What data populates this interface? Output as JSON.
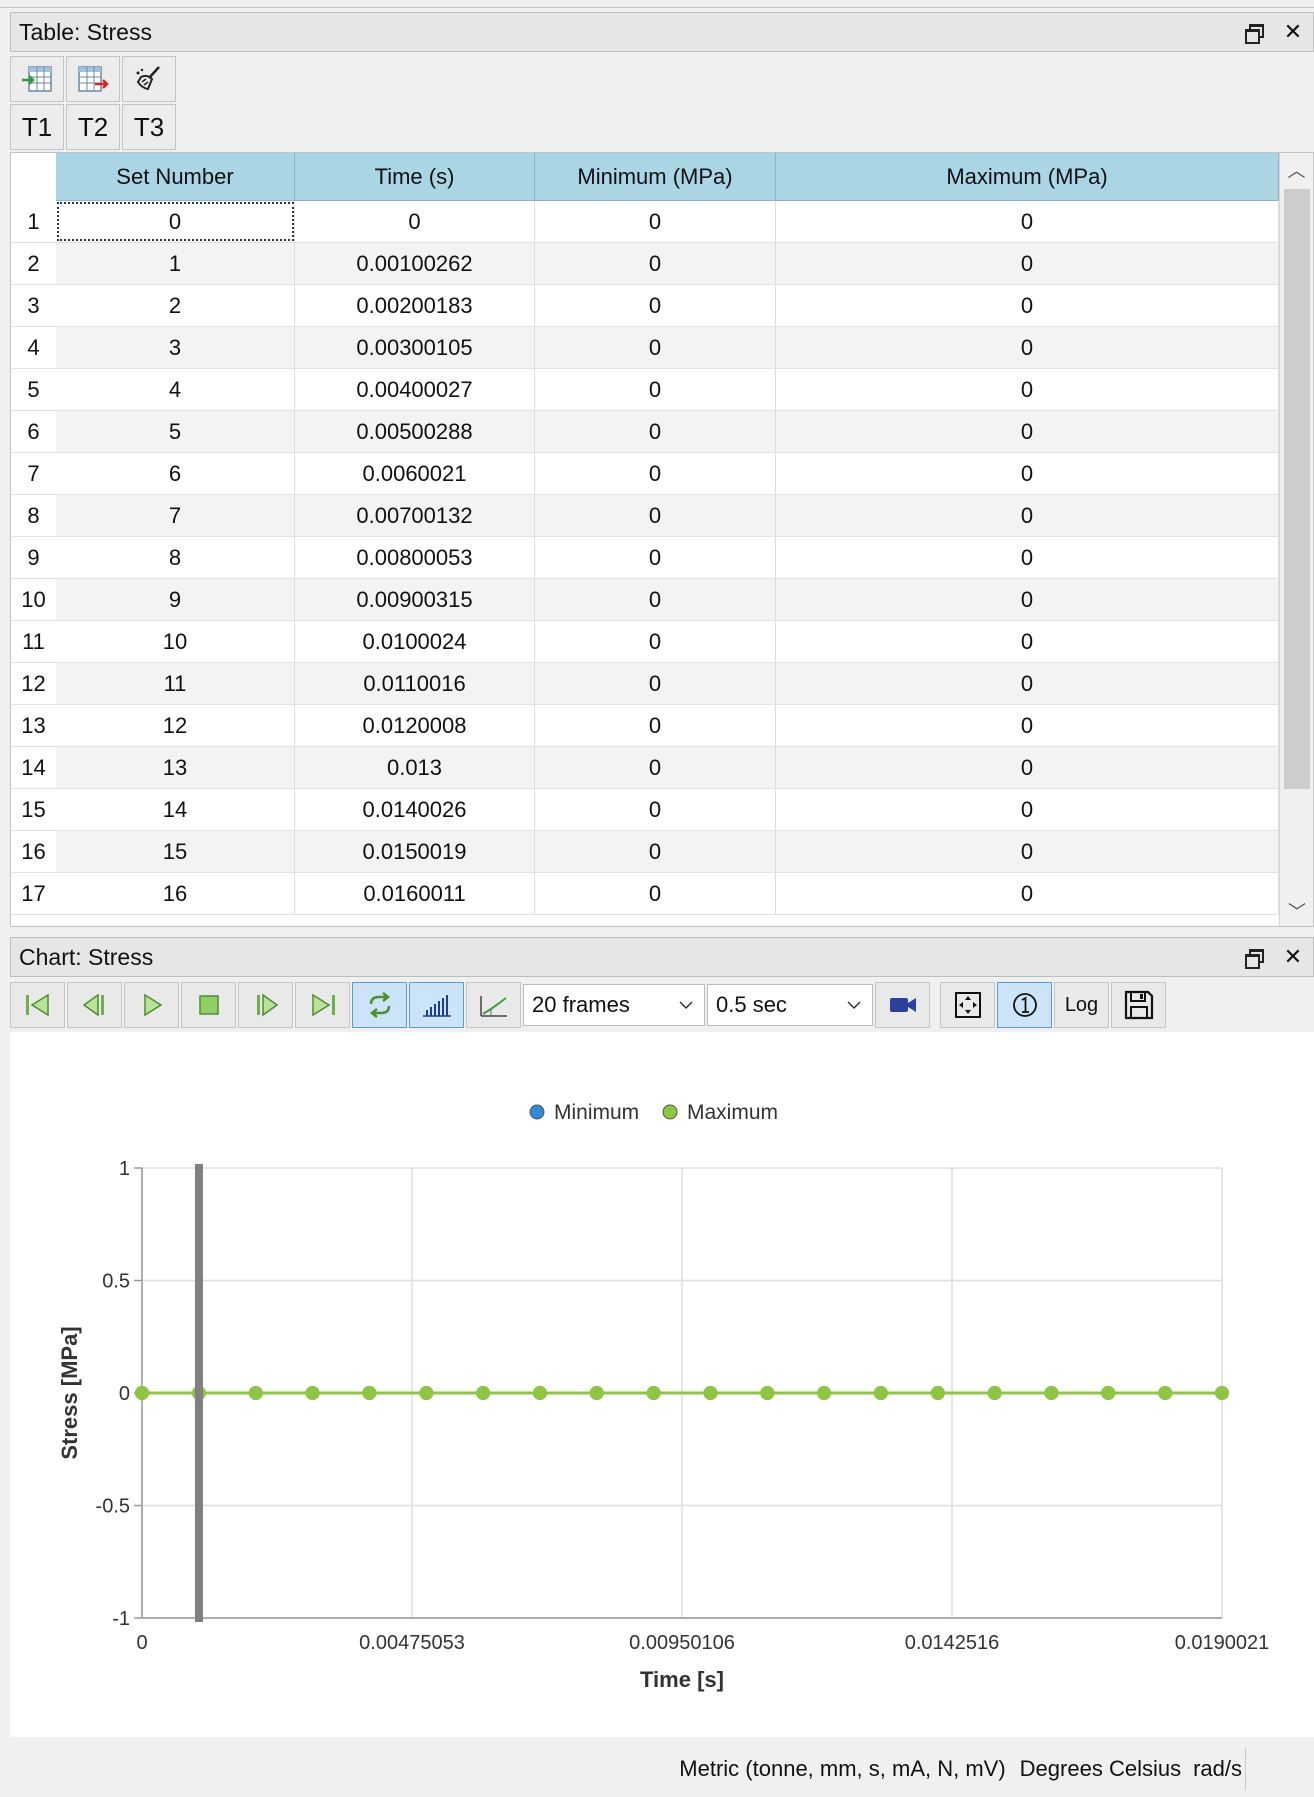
{
  "table_panel": {
    "title": "Table: Stress",
    "tabs": [
      "T1",
      "T2",
      "T3"
    ],
    "columns": [
      "Set Number",
      "Time (s)",
      "Minimum (MPa)",
      "Maximum (MPa)"
    ],
    "rows": [
      {
        "n": "1",
        "set": "0",
        "time": "0",
        "min": "0",
        "max": "0"
      },
      {
        "n": "2",
        "set": "1",
        "time": "0.00100262",
        "min": "0",
        "max": "0"
      },
      {
        "n": "3",
        "set": "2",
        "time": "0.00200183",
        "min": "0",
        "max": "0"
      },
      {
        "n": "4",
        "set": "3",
        "time": "0.00300105",
        "min": "0",
        "max": "0"
      },
      {
        "n": "5",
        "set": "4",
        "time": "0.00400027",
        "min": "0",
        "max": "0"
      },
      {
        "n": "6",
        "set": "5",
        "time": "0.00500288",
        "min": "0",
        "max": "0"
      },
      {
        "n": "7",
        "set": "6",
        "time": "0.0060021",
        "min": "0",
        "max": "0"
      },
      {
        "n": "8",
        "set": "7",
        "time": "0.00700132",
        "min": "0",
        "max": "0"
      },
      {
        "n": "9",
        "set": "8",
        "time": "0.00800053",
        "min": "0",
        "max": "0"
      },
      {
        "n": "10",
        "set": "9",
        "time": "0.00900315",
        "min": "0",
        "max": "0"
      },
      {
        "n": "11",
        "set": "10",
        "time": "0.0100024",
        "min": "0",
        "max": "0"
      },
      {
        "n": "12",
        "set": "11",
        "time": "0.0110016",
        "min": "0",
        "max": "0"
      },
      {
        "n": "13",
        "set": "12",
        "time": "0.0120008",
        "min": "0",
        "max": "0"
      },
      {
        "n": "14",
        "set": "13",
        "time": "0.013",
        "min": "0",
        "max": "0"
      },
      {
        "n": "15",
        "set": "14",
        "time": "0.0140026",
        "min": "0",
        "max": "0"
      },
      {
        "n": "16",
        "set": "15",
        "time": "0.0150019",
        "min": "0",
        "max": "0"
      },
      {
        "n": "17",
        "set": "16",
        "time": "0.0160011",
        "min": "0",
        "max": "0"
      }
    ]
  },
  "chart_panel": {
    "title": "Chart: Stress",
    "frames_select": "20 frames",
    "interval_select": "0.5 sec",
    "log_label": "Log",
    "active_buttons": [
      "loop",
      "bar-chart",
      "mark-one"
    ]
  },
  "chart_data": {
    "type": "line",
    "xlabel": "Time [s]",
    "ylabel": "Stress [MPa]",
    "xlim": [
      0,
      0.0190021
    ],
    "ylim": [
      -1,
      1
    ],
    "x_ticks": [
      "0",
      "0.00475053",
      "0.00950106",
      "0.0142516",
      "0.0190021"
    ],
    "y_ticks": [
      "1",
      "0.5",
      "0",
      "-0.5",
      "-1"
    ],
    "grid": true,
    "legend_position": "top-center",
    "cursor_x": 0.00100262,
    "series": [
      {
        "name": "Minimum",
        "color": "#2f8ad8",
        "x": [
          0,
          0.00100262,
          0.00200183,
          0.00300105,
          0.00400027,
          0.00500288,
          0.0060021,
          0.00700132,
          0.00800053,
          0.00900315,
          0.0100024,
          0.0110016,
          0.0120008,
          0.013,
          0.0140026,
          0.0150019,
          0.0160011,
          0.0170003,
          0.0180029,
          0.0190021
        ],
        "y": [
          0,
          0,
          0,
          0,
          0,
          0,
          0,
          0,
          0,
          0,
          0,
          0,
          0,
          0,
          0,
          0,
          0,
          0,
          0,
          0
        ]
      },
      {
        "name": "Maximum",
        "color": "#8dc63f",
        "x": [
          0,
          0.00100262,
          0.00200183,
          0.00300105,
          0.00400027,
          0.00500288,
          0.0060021,
          0.00700132,
          0.00800053,
          0.00900315,
          0.0100024,
          0.0110016,
          0.0120008,
          0.013,
          0.0140026,
          0.0150019,
          0.0160011,
          0.0170003,
          0.0180029,
          0.0190021
        ],
        "y": [
          0,
          0,
          0,
          0,
          0,
          0,
          0,
          0,
          0,
          0,
          0,
          0,
          0,
          0,
          0,
          0,
          0,
          0,
          0,
          0
        ]
      }
    ]
  },
  "status_bar": {
    "units": "Metric (tonne, mm, s, mA, N, mV)",
    "temperature": "Degrees  Celsius",
    "angular": "rad/s"
  }
}
